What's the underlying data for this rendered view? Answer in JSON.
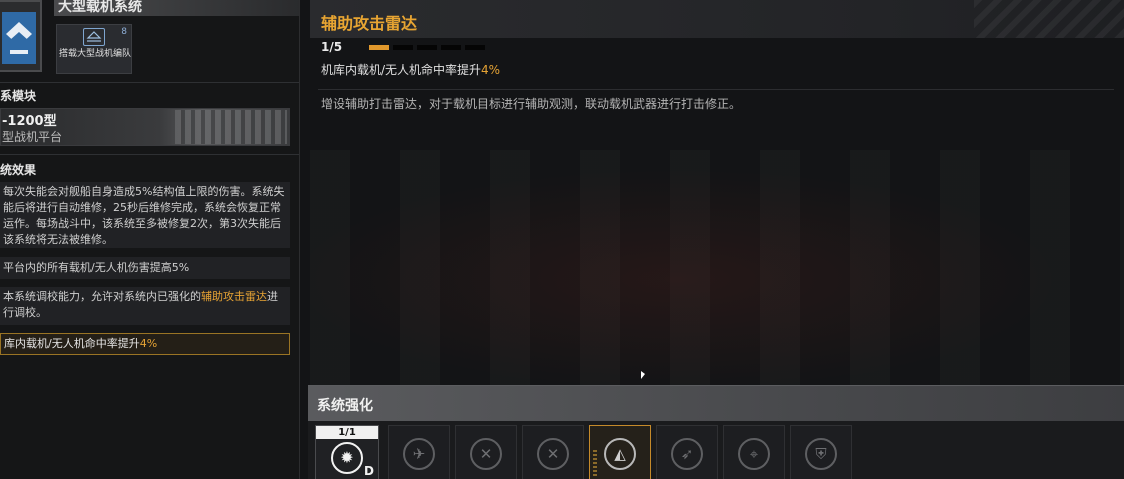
{
  "system": {
    "title": "大型载机系统",
    "hangar_tile": {
      "label": "搭载大型战机编队",
      "count": "8"
    }
  },
  "module": {
    "heading": "系模块",
    "name": "-1200型",
    "subtitle": "型战机平台"
  },
  "effects": {
    "heading": "统效果",
    "items": [
      {
        "text": "每次失能会对舰船自身造成5%结构值上限的伤害。系统失能后将进行自动维修，25秒后维修完成，系统会恢复正常运作。每场战斗中，该系统至多被修复2次，第3次失能后该系统将无法被维修。"
      },
      {
        "text": "平台内的所有载机/无人机伤害提高5%"
      },
      {
        "text_pre": "本系统调校能力，允许对系统内已强化的",
        "highlight": "辅助攻击雷达",
        "text_post": "进行调校。"
      },
      {
        "text_pre": "库内载机/无人机命中率提升",
        "highlight": "4%"
      }
    ]
  },
  "detail": {
    "title": "辅助攻击雷达",
    "level": "1/5",
    "level_current": 1,
    "level_max": 5,
    "stat_label": "机库内载机/无人机命中率提升",
    "stat_value": "4%",
    "description": "增设辅助打击雷达，对于载机目标进行辅助观测，联动载机武器进行打击修正。"
  },
  "enhance": {
    "title": "系统强化",
    "main_slot": {
      "level": "1/1",
      "grade": "D",
      "icon": "flame-emblem-icon"
    },
    "slots": [
      {
        "icon": "fighter-wrench-icon",
        "selected": false
      },
      {
        "icon": "drone-x-icon",
        "selected": false
      },
      {
        "icon": "drone-x-icon",
        "selected": false
      },
      {
        "icon": "radar-dome-icon",
        "selected": true
      },
      {
        "icon": "fighter-arrow-icon",
        "selected": false
      },
      {
        "icon": "signal-tower-icon",
        "selected": false
      },
      {
        "icon": "shield-gear-icon",
        "selected": false
      }
    ]
  },
  "colors": {
    "accent": "#e6a334",
    "selected_border": "#c58a2a",
    "system_icon": "#2f6aa6"
  }
}
